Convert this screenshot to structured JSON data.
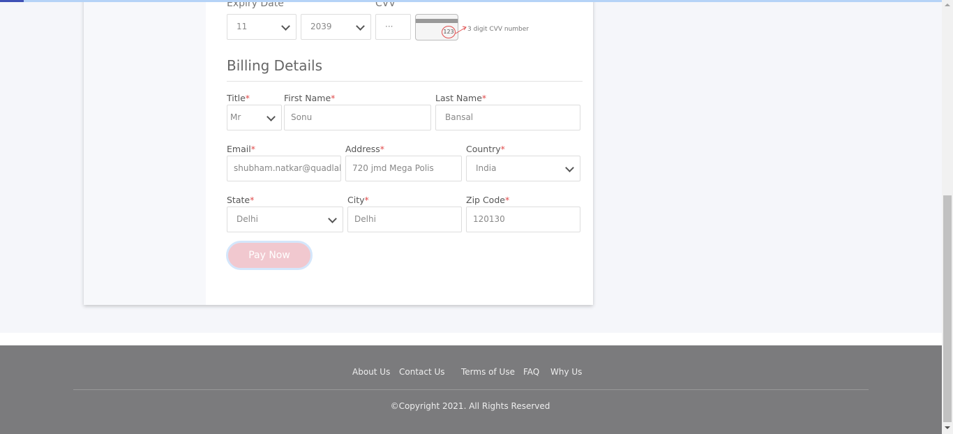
{
  "payment": {
    "expiry_label": "Expiry Date",
    "expiry_month": "11",
    "expiry_year": "2039",
    "cvv_label": "CVV",
    "cvv_value": "···",
    "cvv_sample": "123",
    "cvv_hint": "3 digit CVV number"
  },
  "billing": {
    "heading": "Billing Details",
    "required_mark": "*",
    "title": {
      "label": "Title",
      "value": "Mr"
    },
    "first_name": {
      "label": "First Name",
      "value": "Sonu"
    },
    "last_name": {
      "label": "Last Name",
      "value": "Bansal"
    },
    "email": {
      "label": "Email",
      "value": "shubham.natkar@quadlabs.com"
    },
    "address": {
      "label": "Address",
      "value": "720 jmd Mega Polis"
    },
    "country": {
      "label": "Country",
      "value": "India"
    },
    "state": {
      "label": "State",
      "value": "Delhi"
    },
    "city": {
      "label": "City",
      "value": "Delhi"
    },
    "zip": {
      "label": "Zip Code",
      "value": "120130"
    },
    "pay_button": "Pay Now"
  },
  "footer": {
    "links": [
      "About Us",
      "Contact Us",
      "Terms of Use",
      "FAQ",
      "Why Us"
    ],
    "copyright": "©Copyright 2021. All Rights Reserved"
  }
}
